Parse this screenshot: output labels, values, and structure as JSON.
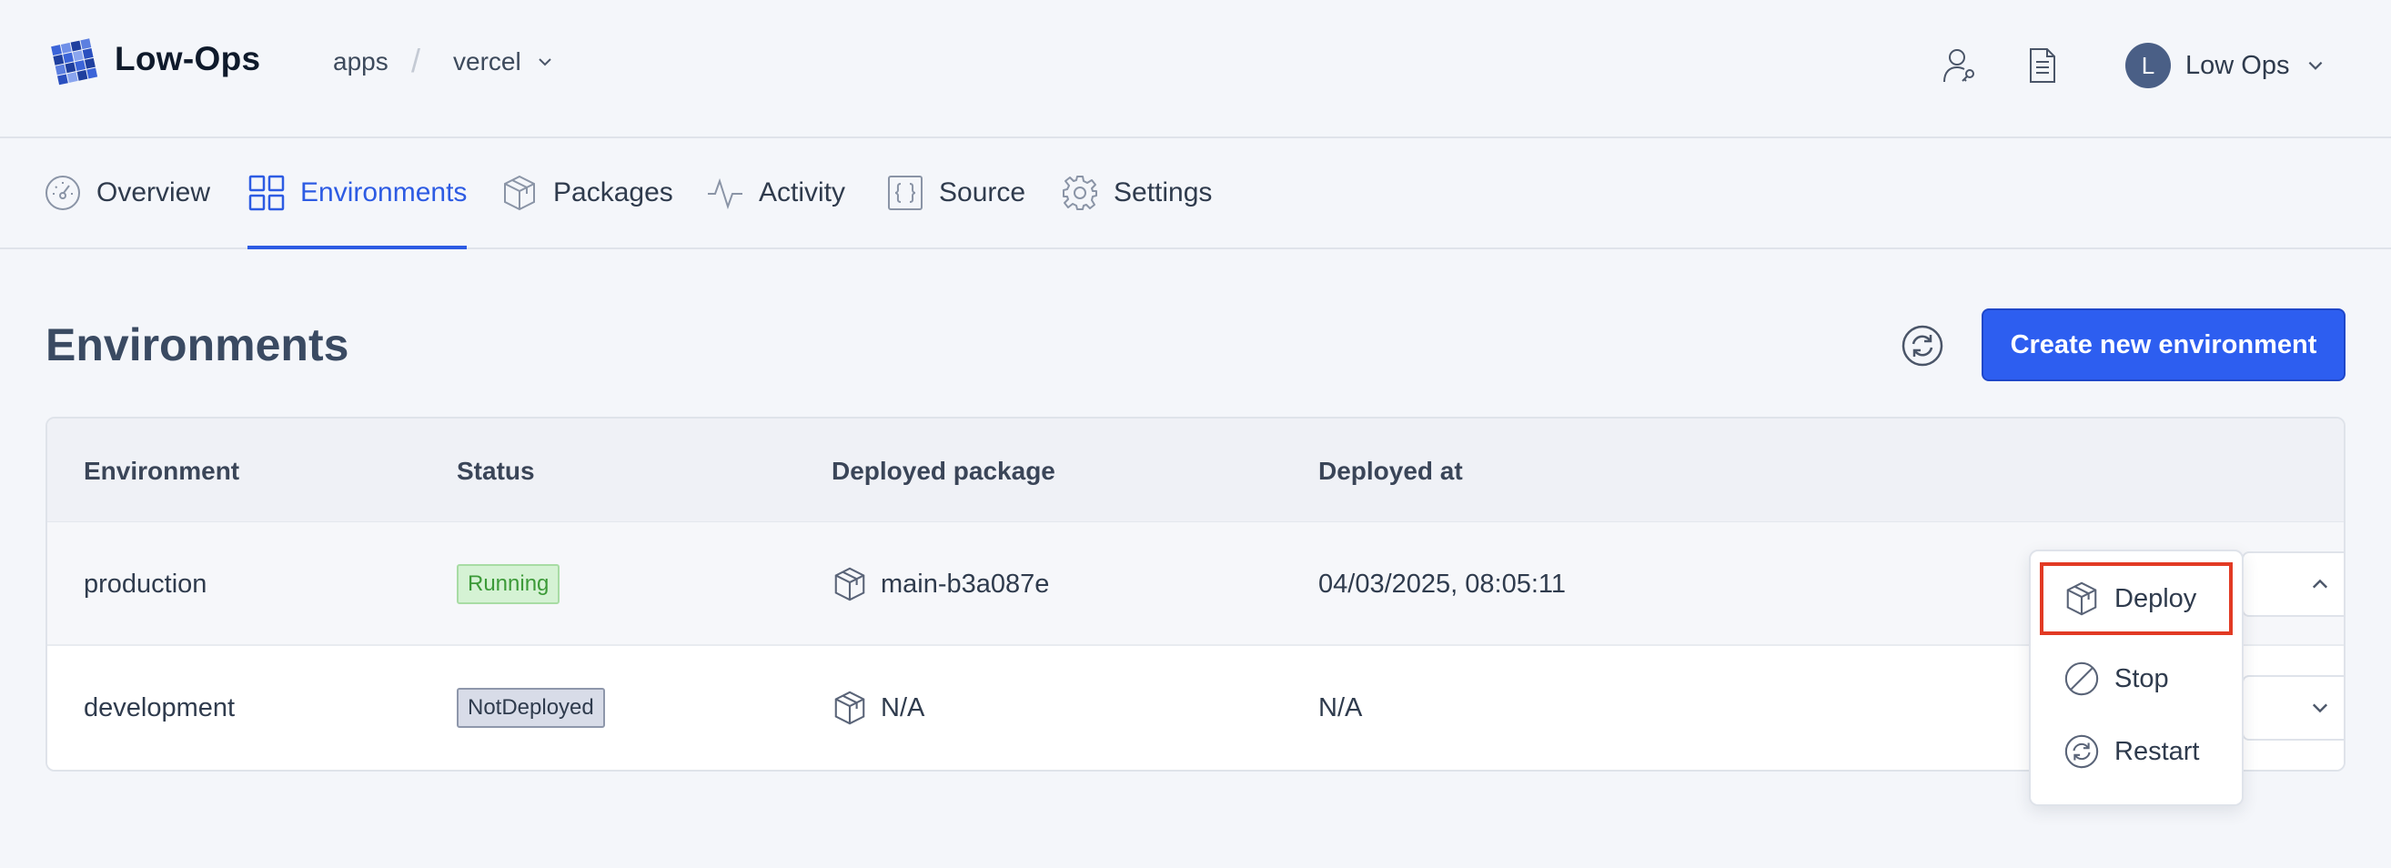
{
  "header": {
    "brand": "Low-Ops",
    "breadcrumb": {
      "root": "apps",
      "separator": "/",
      "current": "vercel"
    },
    "user": {
      "initial": "L",
      "name": "Low Ops"
    }
  },
  "tabs": [
    {
      "label": "Overview",
      "icon": "gauge-icon"
    },
    {
      "label": "Environments",
      "icon": "grid-icon",
      "active": true
    },
    {
      "label": "Packages",
      "icon": "package-icon"
    },
    {
      "label": "Activity",
      "icon": "activity-icon"
    },
    {
      "label": "Source",
      "icon": "code-braces-icon"
    },
    {
      "label": "Settings",
      "icon": "gear-icon"
    }
  ],
  "page": {
    "title": "Environments",
    "create_button": "Create new environment"
  },
  "table": {
    "headers": [
      "Environment",
      "Status",
      "Deployed package",
      "Deployed at"
    ],
    "rows": [
      {
        "environment": "production",
        "status": "Running",
        "package": "main-b3a087e",
        "deployed_at": "04/03/2025, 08:05:11"
      },
      {
        "environment": "development",
        "status": "NotDeployed",
        "package": "N/A",
        "deployed_at": "N/A"
      }
    ]
  },
  "action_menu": {
    "items": [
      {
        "label": "Deploy",
        "icon": "package-icon"
      },
      {
        "label": "Stop",
        "icon": "stop-icon"
      },
      {
        "label": "Restart",
        "icon": "restart-icon"
      }
    ]
  },
  "colors": {
    "accent": "#2d5be3",
    "primary_button": "#2d5ef0",
    "running_bg": "#d5f2d4",
    "running_text": "#3c9a38",
    "highlight": "#e23a24"
  }
}
